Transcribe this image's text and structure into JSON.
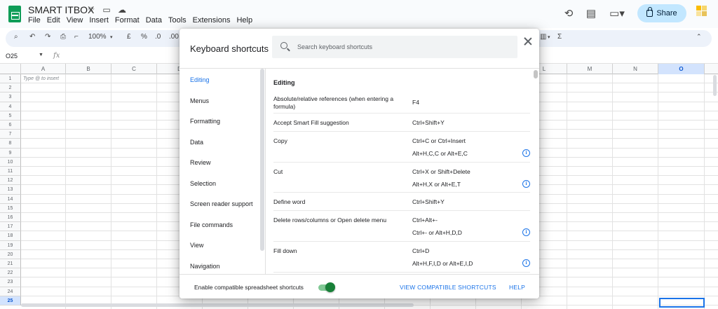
{
  "app": {
    "title": "SMART ITBOX",
    "menu": [
      "File",
      "Edit",
      "View",
      "Insert",
      "Format",
      "Data",
      "Tools",
      "Extensions",
      "Help"
    ],
    "share_label": "Share",
    "title_icons": [
      "star-icon",
      "folder-move-icon",
      "cloud-status-icon"
    ],
    "right_icons": [
      "history-icon",
      "comment-icon",
      "meet-icon"
    ]
  },
  "toolbar": {
    "zoom": "100%",
    "currency": "£",
    "percent": "%",
    "decimal_increase": ".00",
    "sigma": "Σ"
  },
  "formula_bar": {
    "name_box": "O25",
    "fx": "fx"
  },
  "grid": {
    "columns": [
      "A",
      "B",
      "C",
      "D",
      "E",
      "F",
      "G",
      "H",
      "I",
      "J",
      "K",
      "L",
      "M",
      "N",
      "O"
    ],
    "selected_column": "O",
    "rows": [
      "1",
      "2",
      "3",
      "4",
      "5",
      "6",
      "7",
      "8",
      "9",
      "10",
      "11",
      "12",
      "13",
      "14",
      "15",
      "16",
      "17",
      "18",
      "19",
      "20",
      "21",
      "22",
      "23",
      "24",
      "25"
    ],
    "selected_row": "25",
    "hint": "Type @ to insert"
  },
  "dialog": {
    "title": "Keyboard shortcuts",
    "search_placeholder": "Search keyboard shortcuts",
    "categories": [
      {
        "label": "Editing",
        "active": true
      },
      {
        "label": "Menus",
        "active": false
      },
      {
        "label": "Formatting",
        "active": false
      },
      {
        "label": "Data",
        "active": false
      },
      {
        "label": "Review",
        "active": false
      },
      {
        "label": "Selection",
        "active": false
      },
      {
        "label": "Screen reader support",
        "active": false
      },
      {
        "label": "File commands",
        "active": false
      },
      {
        "label": "View",
        "active": false
      },
      {
        "label": "Navigation",
        "active": false
      }
    ],
    "section_title": "Editing",
    "shortcuts": [
      {
        "action": "Absolute/relative references (when entering a formula)",
        "keys": [
          "F4"
        ],
        "info": false
      },
      {
        "action": "Accept Smart Fill suggestion",
        "keys": [
          "Ctrl+Shift+Y"
        ],
        "info": false
      },
      {
        "action": "Copy",
        "keys": [
          "Ctrl+C or Ctrl+Insert",
          "Alt+H,C,C or Alt+E,C"
        ],
        "info": true
      },
      {
        "action": "Cut",
        "keys": [
          "Ctrl+X or Shift+Delete",
          "Alt+H,X or Alt+E,T"
        ],
        "info": true
      },
      {
        "action": "Define word",
        "keys": [
          "Ctrl+Shift+Y"
        ],
        "info": false
      },
      {
        "action": "Delete rows/columns or Open delete menu",
        "keys": [
          "Ctrl+Alt+-",
          "Ctrl+- or Alt+H,D,D"
        ],
        "info": true
      },
      {
        "action": "Fill down",
        "keys": [
          "Ctrl+D",
          "Alt+H,F,I,D or Alt+E,I,D"
        ],
        "info": true
      }
    ],
    "footer": {
      "toggle_label": "Enable compatible spreadsheet shortcuts",
      "toggle_on": true,
      "view_link": "VIEW COMPATIBLE SHORTCUTS",
      "help_link": "HELP"
    }
  },
  "colors": {
    "accent": "#1a73e8",
    "sheets_green": "#0f9d58",
    "toggle_on": "#188038",
    "share_bg": "#c2e7ff"
  }
}
